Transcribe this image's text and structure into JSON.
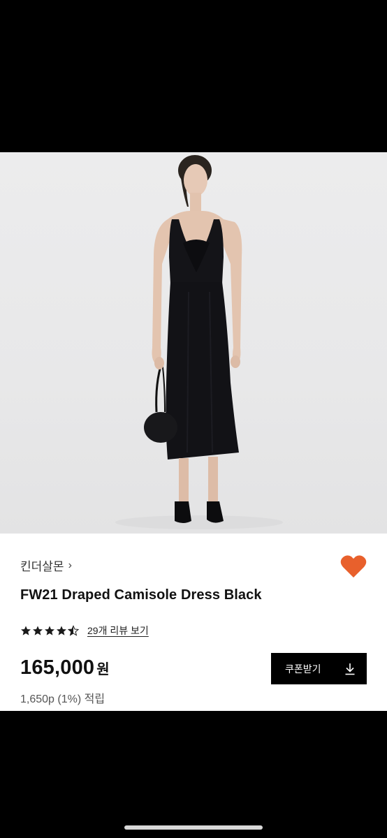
{
  "product": {
    "brand": "킨더살몬",
    "brand_chevron": "›",
    "title": "FW21 Draped Camisole Dress Black",
    "rating": 4.5,
    "review_link": "29개 리뷰 보기",
    "price": "165,000",
    "price_unit": "원",
    "points": "1,650p (1%) 적립",
    "coupon_button": "쿠폰받기"
  },
  "colors": {
    "heart": "#e8602c",
    "button_bg": "#000000",
    "stars": "#1a1a1a"
  },
  "icons": {
    "wishlist": "heart-icon",
    "download": "download-icon",
    "star": "star-icon"
  }
}
